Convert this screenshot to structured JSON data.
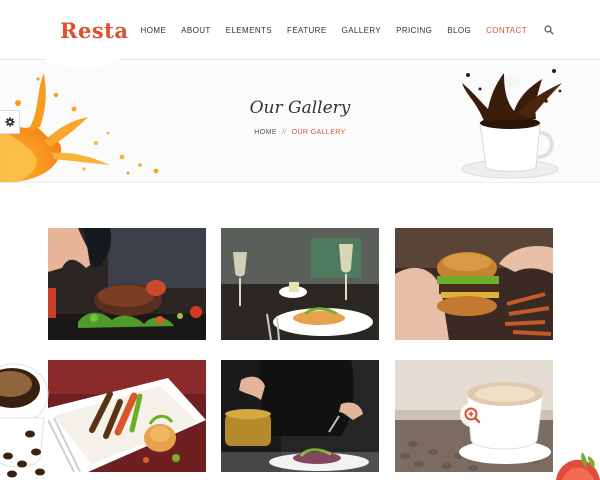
{
  "brand": {
    "name": "Resta",
    "accent": "#d9532f"
  },
  "nav": {
    "items": [
      {
        "label": "HOME"
      },
      {
        "label": "ABOUT"
      },
      {
        "label": "ELEMENTS"
      },
      {
        "label": "FEATURE"
      },
      {
        "label": "GALLERY"
      },
      {
        "label": "PRICING"
      },
      {
        "label": "BLOG"
      },
      {
        "label": "CONTACT",
        "active": true
      }
    ],
    "search_icon": "search-icon"
  },
  "banner": {
    "title": "Our Gallery",
    "breadcrumb": {
      "home": "HOME",
      "separator": "//",
      "current": "OUR GALLERY"
    }
  },
  "settings_icon": "gear-icon",
  "gallery": {
    "tiles": [
      {
        "subject": "steak-with-salad"
      },
      {
        "subject": "restaurant-table-with-fish"
      },
      {
        "subject": "burger-in-hands"
      },
      {
        "subject": "grilled-vegetables-plate"
      },
      {
        "subject": "chef-plating-dish"
      },
      {
        "subject": "cappuccino-with-coffee-beans",
        "hover_icon": "zoom-icon"
      }
    ]
  }
}
